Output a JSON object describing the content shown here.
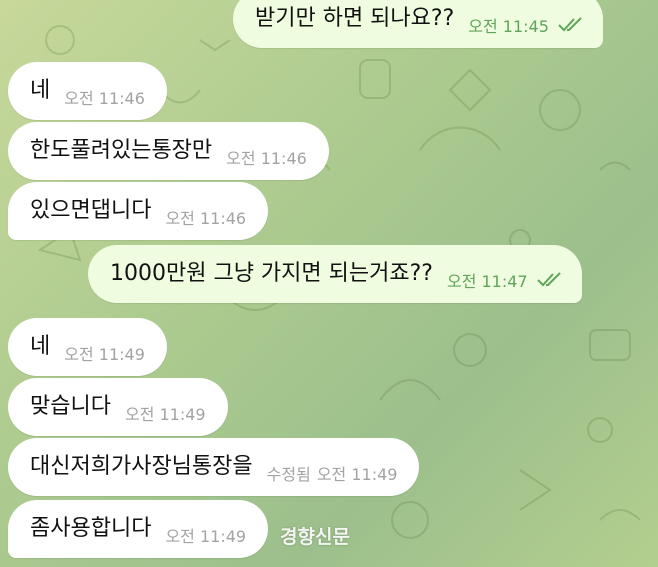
{
  "messages": [
    {
      "id": "m1",
      "side": "out",
      "text": "받기만 하면 되나요??",
      "time": "오전 11:45",
      "read": true
    },
    {
      "id": "m2",
      "side": "in",
      "text": "네",
      "time": "오전 11:46"
    },
    {
      "id": "m3",
      "side": "in",
      "text": "한도풀려있는통장만",
      "time": "오전 11:46"
    },
    {
      "id": "m4",
      "side": "in",
      "text": "있으면댑니다",
      "time": "오전 11:46"
    },
    {
      "id": "m5",
      "side": "out",
      "text": "1000만원 그냥 가지면 되는거죠??",
      "time": "오전 11:47",
      "read": true
    },
    {
      "id": "m6",
      "side": "in",
      "text": "네",
      "time": "오전 11:49"
    },
    {
      "id": "m7",
      "side": "in",
      "text": "맞습니다",
      "time": "오전 11:49"
    },
    {
      "id": "m8",
      "side": "in",
      "text": "대신저희가사장님통장을",
      "time": "오전 11:49",
      "edited": "수정됨"
    },
    {
      "id": "m9",
      "side": "in",
      "text": "좀사용합니다",
      "time": "오전 11:49"
    }
  ],
  "watermark": "경향신문",
  "colors": {
    "incoming_bubble": "#ffffff",
    "outgoing_bubble": "#effcdf",
    "outgoing_meta": "#5fa55a",
    "incoming_meta": "#a3a3a3"
  },
  "icons": {
    "read_receipt": "double-check-icon"
  }
}
